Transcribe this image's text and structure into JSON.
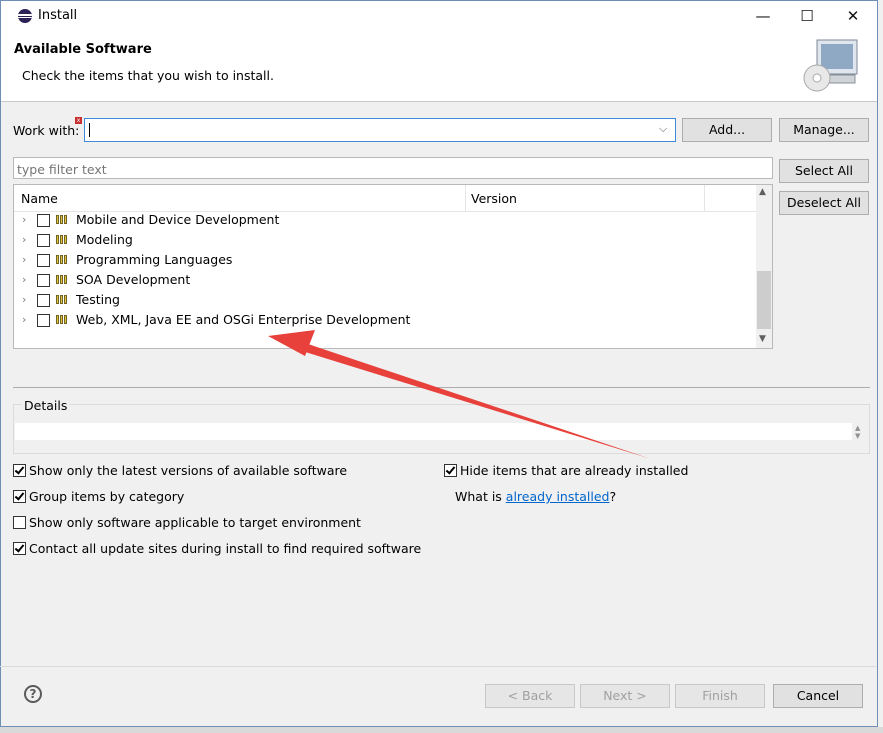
{
  "window": {
    "title": "Install",
    "minimize": "—",
    "maximize": "☐",
    "close": "✕"
  },
  "header": {
    "title": "Available Software",
    "subtitle": "Check the items that you wish to install."
  },
  "work_with": {
    "label": "Work with:",
    "value": "",
    "add_button": "Add...",
    "manage_button": "Manage..."
  },
  "filter": {
    "placeholder": "type filter text"
  },
  "side_buttons": {
    "select_all": "Select All",
    "deselect_all": "Deselect All"
  },
  "tree": {
    "columns": [
      "Name",
      "Version"
    ],
    "rows": [
      {
        "label": "Mobile and Device Development",
        "checked": false
      },
      {
        "label": "Modeling",
        "checked": false
      },
      {
        "label": "Programming Languages",
        "checked": false
      },
      {
        "label": "SOA Development",
        "checked": false
      },
      {
        "label": "Testing",
        "checked": false
      },
      {
        "label": "Web, XML, Java EE and OSGi Enterprise Development",
        "checked": false
      }
    ]
  },
  "details": {
    "label": "Details"
  },
  "options": {
    "latest_versions": {
      "label": "Show only the latest versions of available software",
      "checked": true
    },
    "group_by_category": {
      "label": "Group items by category",
      "checked": true
    },
    "target_env": {
      "label": "Show only software applicable to target environment",
      "checked": false
    },
    "contact_sites": {
      "label": "Contact all update sites during install to find required software",
      "checked": true
    },
    "hide_installed": {
      "label": "Hide items that are already installed",
      "checked": true
    },
    "what_is_prefix": "What is",
    "what_is_link": "already installed",
    "what_is_suffix": "?"
  },
  "footer": {
    "help": "?",
    "back": "< Back",
    "next": "Next >",
    "finish": "Finish",
    "cancel": "Cancel"
  },
  "colors": {
    "accent_border": "#3c8ad8",
    "arrow": "#e8403a",
    "link": "#0066cc"
  }
}
